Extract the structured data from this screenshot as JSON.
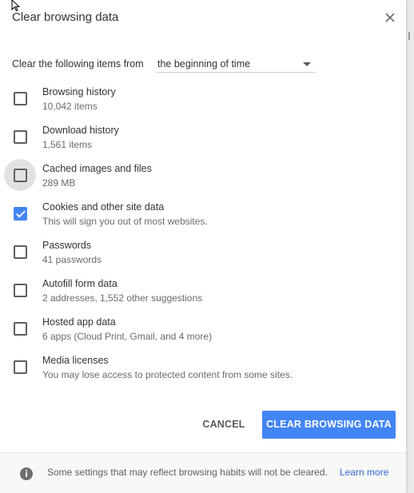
{
  "dialog": {
    "title": "Clear browsing data"
  },
  "time_range": {
    "label": "Clear the following items from",
    "selected": "the beginning of time"
  },
  "items": [
    {
      "label": "Browsing history",
      "detail": "10,042 items",
      "checked": false
    },
    {
      "label": "Download history",
      "detail": "1,561 items",
      "checked": false
    },
    {
      "label": "Cached images and files",
      "detail": "289 MB",
      "checked": false
    },
    {
      "label": "Cookies and other site data",
      "detail": "This will sign you out of most websites.",
      "checked": true
    },
    {
      "label": "Passwords",
      "detail": "41 passwords",
      "checked": false
    },
    {
      "label": "Autofill form data",
      "detail": "2 addresses, 1,552 other suggestions",
      "checked": false
    },
    {
      "label": "Hosted app data",
      "detail": "6 apps (Cloud Print, Gmail, and 4 more)",
      "checked": false
    },
    {
      "label": "Media licenses",
      "detail": "You may lose access to protected content from some sites.",
      "checked": false
    }
  ],
  "buttons": {
    "cancel": "CANCEL",
    "clear": "CLEAR BROWSING DATA"
  },
  "footer": {
    "text": "Some settings that may reflect browsing habits will not be cleared.",
    "link": "Learn more"
  },
  "colors": {
    "accent": "#4285f4",
    "link": "#3367d6"
  },
  "icons": {
    "close": "close-icon",
    "dropdown": "chevron-down-icon",
    "info": "info-icon",
    "cursor": "mouse-pointer-icon"
  }
}
